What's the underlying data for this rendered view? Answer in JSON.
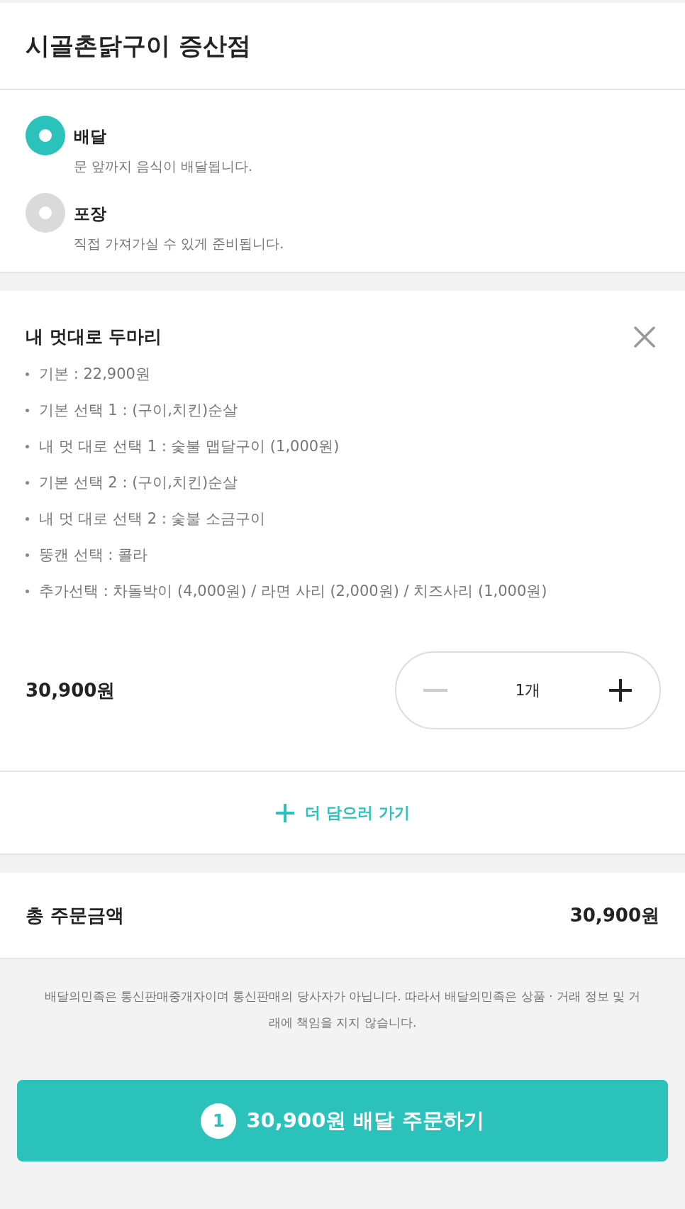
{
  "header": {
    "title": "시골촌닭구이 증산점"
  },
  "order_types": [
    {
      "label": "배달",
      "description": "문 앞까지 음식이 배달됩니다.",
      "selected": true
    },
    {
      "label": "포장",
      "description": "직접 가져가실 수 있게 준비됩니다.",
      "selected": false
    }
  ],
  "cart_item": {
    "name": "내 멋대로 두마리",
    "options": [
      "기본 : 22,900원",
      "기본 선택 1 : (구이,치킨)순살",
      "내 멋 대로 선택 1 : 숯불 맵달구이 (1,000원)",
      "기본 선택 2 : (구이,치킨)순살",
      "내 멋 대로 선택 2 : 숯불 소금구이",
      "뚱캔 선택 : 콜라",
      "추가선택 : 차돌박이 (4,000원) / 라면 사리 (2,000원) / 치즈사리 (1,000원)"
    ],
    "price": "30,900원",
    "quantity": "1개"
  },
  "add_more": {
    "label": "더 담으러 가기"
  },
  "total": {
    "label": "총 주문금액",
    "amount": "30,900원"
  },
  "disclaimer": "배달의민족은 통신판매중개자이며 통신판매의 당사자가 아닙니다. 따라서 배달의민족은 상품 · 거래 정보 및 거래에 책임을 지지 않습니다.",
  "order_button": {
    "count": "1",
    "label": "30,900원 배달 주문하기"
  }
}
